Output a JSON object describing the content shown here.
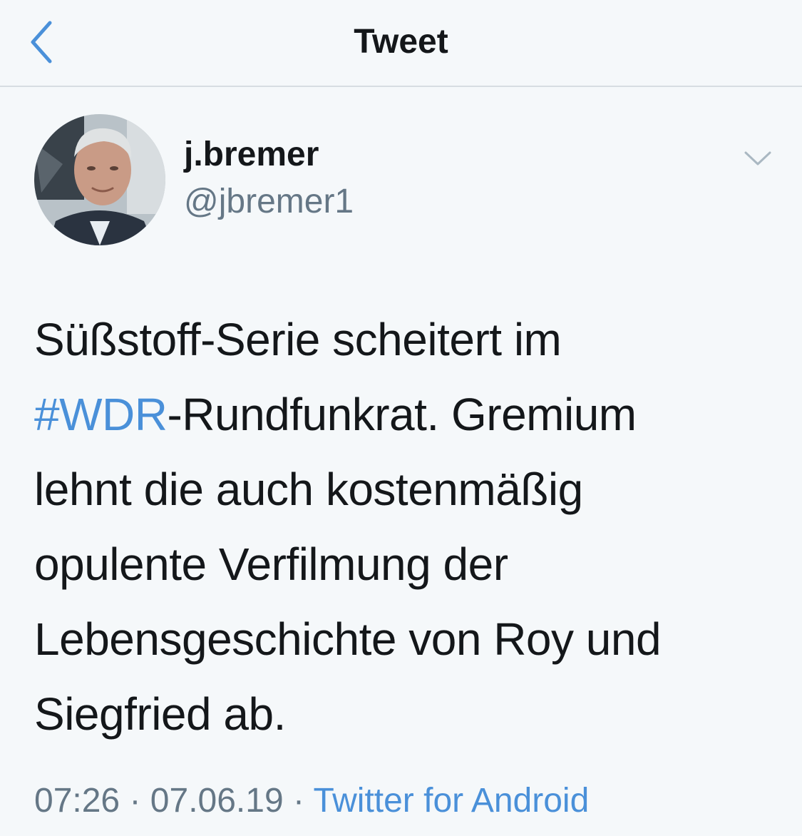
{
  "header": {
    "title": "Tweet"
  },
  "author": {
    "display_name": "j.bremer",
    "handle": "@jbremer1"
  },
  "tweet": {
    "lines": [
      [
        "Süßstoff-Serie scheitert im"
      ],
      [
        "#WDR",
        "-Rundfunkrat. Gremium"
      ],
      [
        "lehnt die auch kostenmäßig"
      ],
      [
        "opulente Verfilmung der"
      ],
      [
        "Lebensgeschichte von Roy und"
      ],
      [
        "Siegfried ab."
      ]
    ]
  },
  "meta": {
    "time": "07:26",
    "separator": "·",
    "date": "07.06.19",
    "source": "Twitter for Android"
  },
  "icons": {
    "back": "back-chevron-icon",
    "menu": "chevron-down-icon"
  },
  "colors": {
    "background": "#f5f8fa",
    "accent": "#4a90d9",
    "secondary_text": "#657786",
    "primary_text": "#14171a"
  }
}
